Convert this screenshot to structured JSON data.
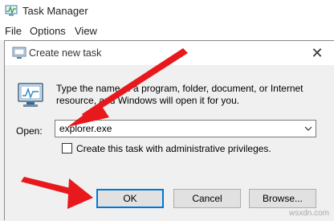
{
  "task_manager": {
    "title": "Task Manager",
    "menu": [
      {
        "label": "File"
      },
      {
        "label": "Options"
      },
      {
        "label": "View"
      }
    ]
  },
  "dialog": {
    "title": "Create new task",
    "description": "Type the name of a program, folder, document, or Internet resource, and Windows will open it for you.",
    "open_label": "Open:",
    "open_value": "explorer.exe",
    "admin_checkbox_label": "Create this task with administrative privileges.",
    "admin_checked": false,
    "buttons": {
      "ok": "OK",
      "cancel": "Cancel",
      "browse": "Browse..."
    }
  },
  "colors": {
    "annotation_arrow": "#e8191c",
    "default_button_border": "#0078d7"
  },
  "watermark": "wsxdn.com"
}
